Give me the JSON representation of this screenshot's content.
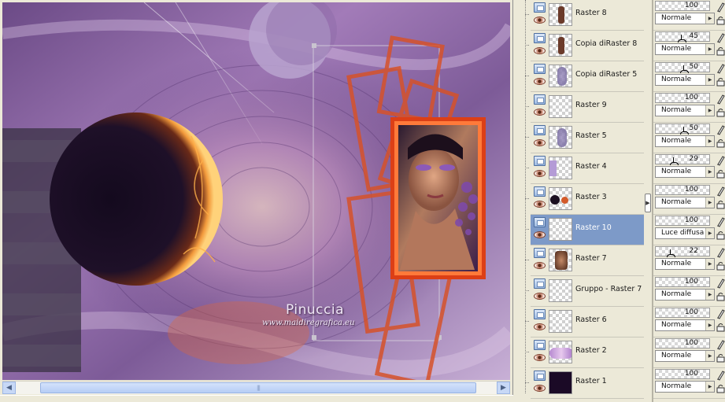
{
  "canvas": {
    "watermark_title": "Pinuccia",
    "watermark_url": "www.maidiregrafica.eu"
  },
  "scrollbar": {
    "left_arrow": "◀",
    "right_arrow": "▶",
    "grip": "|||"
  },
  "splitter": {
    "arrow": "▶"
  },
  "layers": [
    {
      "name": "Raster 8",
      "thumb": "portrait-small",
      "opacity": "100",
      "blend": "Normale",
      "selected": false
    },
    {
      "name": "Copia diRaster 8",
      "thumb": "portrait-small",
      "opacity": "45",
      "blend": "Normale",
      "selected": false
    },
    {
      "name": "Copia diRaster 5",
      "thumb": "purple-figure",
      "opacity": "50",
      "blend": "Normale",
      "selected": false
    },
    {
      "name": "Raster 9",
      "thumb": "transparent",
      "opacity": "100",
      "blend": "Normale",
      "selected": false
    },
    {
      "name": "Raster 5",
      "thumb": "purple-figure",
      "opacity": "50",
      "blend": "Normale",
      "selected": false
    },
    {
      "name": "Raster 4",
      "thumb": "lavender-strip",
      "opacity": "29",
      "blend": "Normale",
      "selected": false
    },
    {
      "name": "Raster 3",
      "thumb": "dark-orbs",
      "opacity": "100",
      "blend": "Normale",
      "selected": false
    },
    {
      "name": "Raster 10",
      "thumb": "transparent",
      "opacity": "100",
      "blend": "Luce diffusa",
      "selected": true
    },
    {
      "name": "Raster 7",
      "thumb": "portrait-face",
      "opacity": "22",
      "blend": "Normale",
      "selected": false
    },
    {
      "name": "Gruppo - Raster 7",
      "thumb": "transparent",
      "opacity": "100",
      "blend": "Normale",
      "selected": false
    },
    {
      "name": "Raster 6",
      "thumb": "transparent",
      "opacity": "100",
      "blend": "Normale",
      "selected": false
    },
    {
      "name": "Raster 2",
      "thumb": "purple-cloud",
      "opacity": "100",
      "blend": "Normale",
      "selected": false
    },
    {
      "name": "Raster 1",
      "thumb": "dark-fill",
      "opacity": "100",
      "blend": "Normale",
      "selected": false
    }
  ],
  "colors": {
    "selection": "#7d9ac8",
    "frame_orange": "#e0441a",
    "panel_bg": "#ece9d8"
  }
}
